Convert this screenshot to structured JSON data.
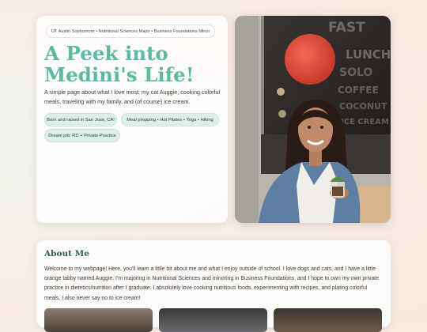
{
  "hero": {
    "tagline": "UT Austin Sophomore • Nutritional Sciences Major • Business Foundations Minor",
    "title": "A Peek into Medini's Life!",
    "intro": "A simple page about what I love most: my cat Auggie, cooking colorful meals, traveling with my family, and (of course) ice cream.",
    "chips": [
      "Born and raised in San Jose, CA!",
      "Meal prepping • Hot Pilates • Yoga • Hiking",
      "Dream job: RD + Private Practice"
    ]
  },
  "photo": {
    "window_lettering": "FAST LUNCH SOLO COFFEE COCONUT MILK ICE CREAM",
    "colors": {
      "wall": "#b6b2ab",
      "lamp": "#e24a3a",
      "jacket": "#5d7fa3",
      "hair": "#2a1b17",
      "table": "#d7b48a"
    }
  },
  "about": {
    "heading": "About Me",
    "body": "Welcome to my webpage! Here, you'll learn a little bit about me and what I enjoy outside of school. I love dogs and cats, and I have a little orange tabby named Auggie. I'm majoring in Nutritional Sciences and minoring in Business Foundations, and I hope to own my own private practice in dietetics/nutrition after I graduate. I absolutely love cooking nutritious foods, experimenting with recipes, and plating colorful meals. I also never say no to ice cream!"
  },
  "colors": {
    "accent": "#5cb9a3",
    "heading": "#2f5f56",
    "chip_bg": "#dcefe8"
  }
}
